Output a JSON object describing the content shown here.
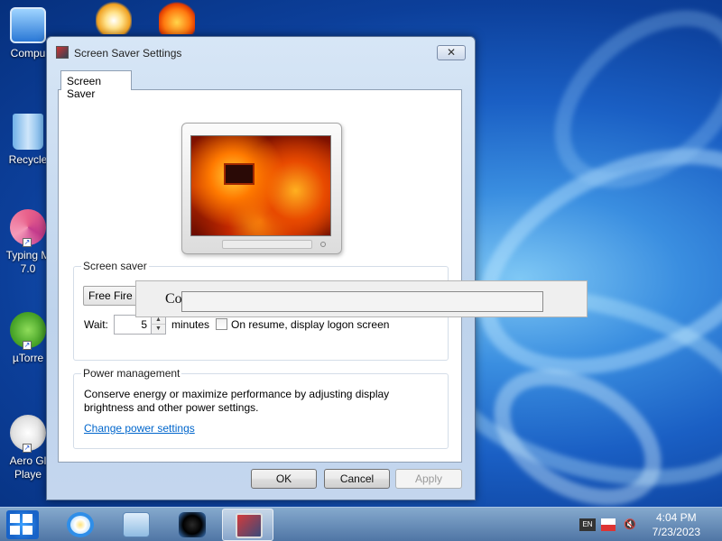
{
  "desktop": {
    "icons": [
      {
        "label": "Compu",
        "icon": "computer-icon"
      },
      {
        "label": "Recycle",
        "icon": "recycle-bin-icon"
      },
      {
        "label": "Typing M",
        "label2": "7.0",
        "icon": "typing-master-icon"
      },
      {
        "label": "µTorre",
        "icon": "utorrent-icon"
      },
      {
        "label": "Aero Gl",
        "label2": "Playe",
        "icon": "aero-glass-player-icon"
      }
    ]
  },
  "dialog": {
    "title": "Screen Saver Settings",
    "close_glyph": "✕",
    "tab": "Screen Saver",
    "screen_saver_group": {
      "label": "Screen saver",
      "selected": "Free Fire Screensaver",
      "wait_label": "Wait:",
      "wait_value": "5",
      "minutes_label": "minutes",
      "resume_label": "On resume, display logon screen",
      "resume_checked": false
    },
    "power_group": {
      "label": "Power management",
      "text": "Conserve energy or maximize performance by adjusting display brightness and other power settings.",
      "link": "Change power settings"
    },
    "buttons": {
      "ok": "OK",
      "cancel": "Cancel",
      "apply": "Apply"
    }
  },
  "overlay": {
    "text": "Co                                                 ll                              l                                 hal"
  },
  "taskbar": {
    "pinned": [
      "start-button",
      "internet-explorer-icon",
      "file-explorer-icon",
      "media-player-icon",
      "screen-saver-settings-icon"
    ],
    "tray": {
      "keyboard": "EN",
      "time": "4:04 PM",
      "date": "7/23/2023"
    }
  },
  "colors": {
    "accent": "#0066cc",
    "desktop": "#1a5fc4"
  }
}
